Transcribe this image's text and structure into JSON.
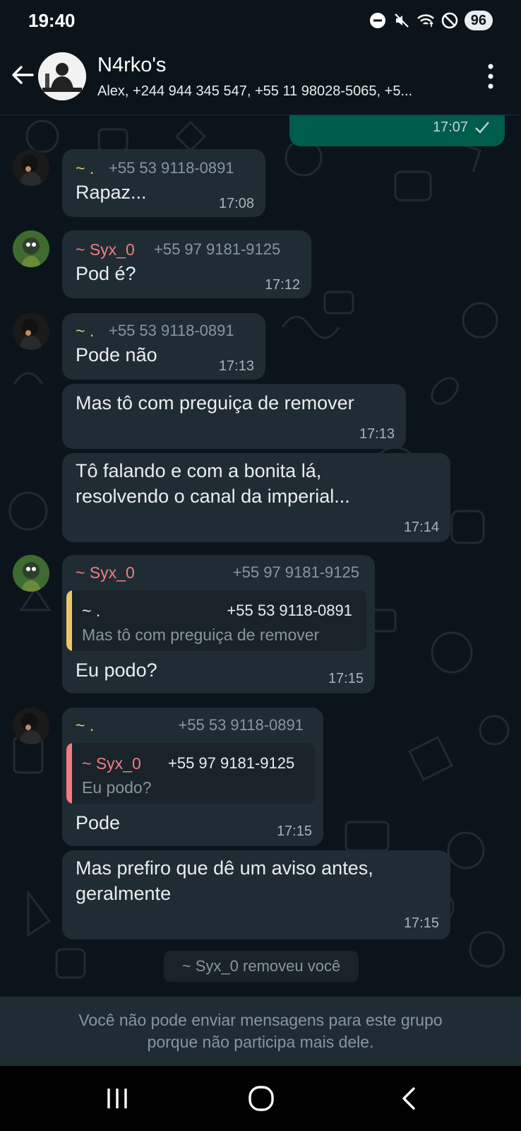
{
  "status_bar": {
    "time": "19:40",
    "battery": "96"
  },
  "header": {
    "title": "N4rko's",
    "subtitle": "Alex, +244 944 345 547, +55 11 98028-5065, +5..."
  },
  "colors": {
    "accent_tilde_dot": "#e8c86a",
    "syx_name": "#f17c84",
    "outgoing_bubble": "#005c4b",
    "incoming_bubble": "#202c33",
    "background": "#0b141a"
  },
  "messages": [
    {
      "time": "17:07",
      "direction": "out",
      "status": "sent-check-icon"
    },
    {
      "sender": "~ .",
      "phone": "+55 53 9118-0891",
      "text": "Rapaz...",
      "time": "17:08"
    },
    {
      "sender": "~ Syx_0",
      "phone": "+55 97 9181-9125",
      "text": "Pod é?",
      "time": "17:12"
    },
    {
      "sender": "~ .",
      "phone": "+55 53 9118-0891",
      "text": "Pode não",
      "time": "17:13"
    },
    {
      "text": "Mas tô com preguiça de remover",
      "time": "17:13"
    },
    {
      "text_line1": "Tô falando e com a bonita lá,",
      "text_line2": "resolvendo o canal da imperial...",
      "time": "17:14"
    },
    {
      "sender": "~ Syx_0",
      "phone": "+55 97 9181-9125",
      "quote": {
        "sender": "~ .",
        "phone": "+55 53 9118-0891",
        "text": "Mas tô com preguiça de remover"
      },
      "text": "Eu podo?",
      "time": "17:15"
    },
    {
      "sender": "~ .",
      "phone": "+55 53 9118-0891",
      "quote": {
        "sender": "~ Syx_0",
        "phone": "+55 97 9181-9125",
        "text": "Eu podo?"
      },
      "text": "Pode",
      "time": "17:15"
    },
    {
      "text_line1": "Mas prefiro que dê um aviso antes,",
      "text_line2": "geralmente",
      "time": "17:15"
    }
  ],
  "system_message": "~ Syx_0 removeu você",
  "footer": {
    "line1": "Você não pode enviar mensagens para este grupo",
    "line2": "porque não participa mais dele."
  },
  "icons": {
    "back": "arrow-left-icon",
    "menu": "more-vertical-icon",
    "nav_recent": "recent-apps-icon",
    "nav_home": "home-icon",
    "nav_back": "nav-back-icon"
  }
}
